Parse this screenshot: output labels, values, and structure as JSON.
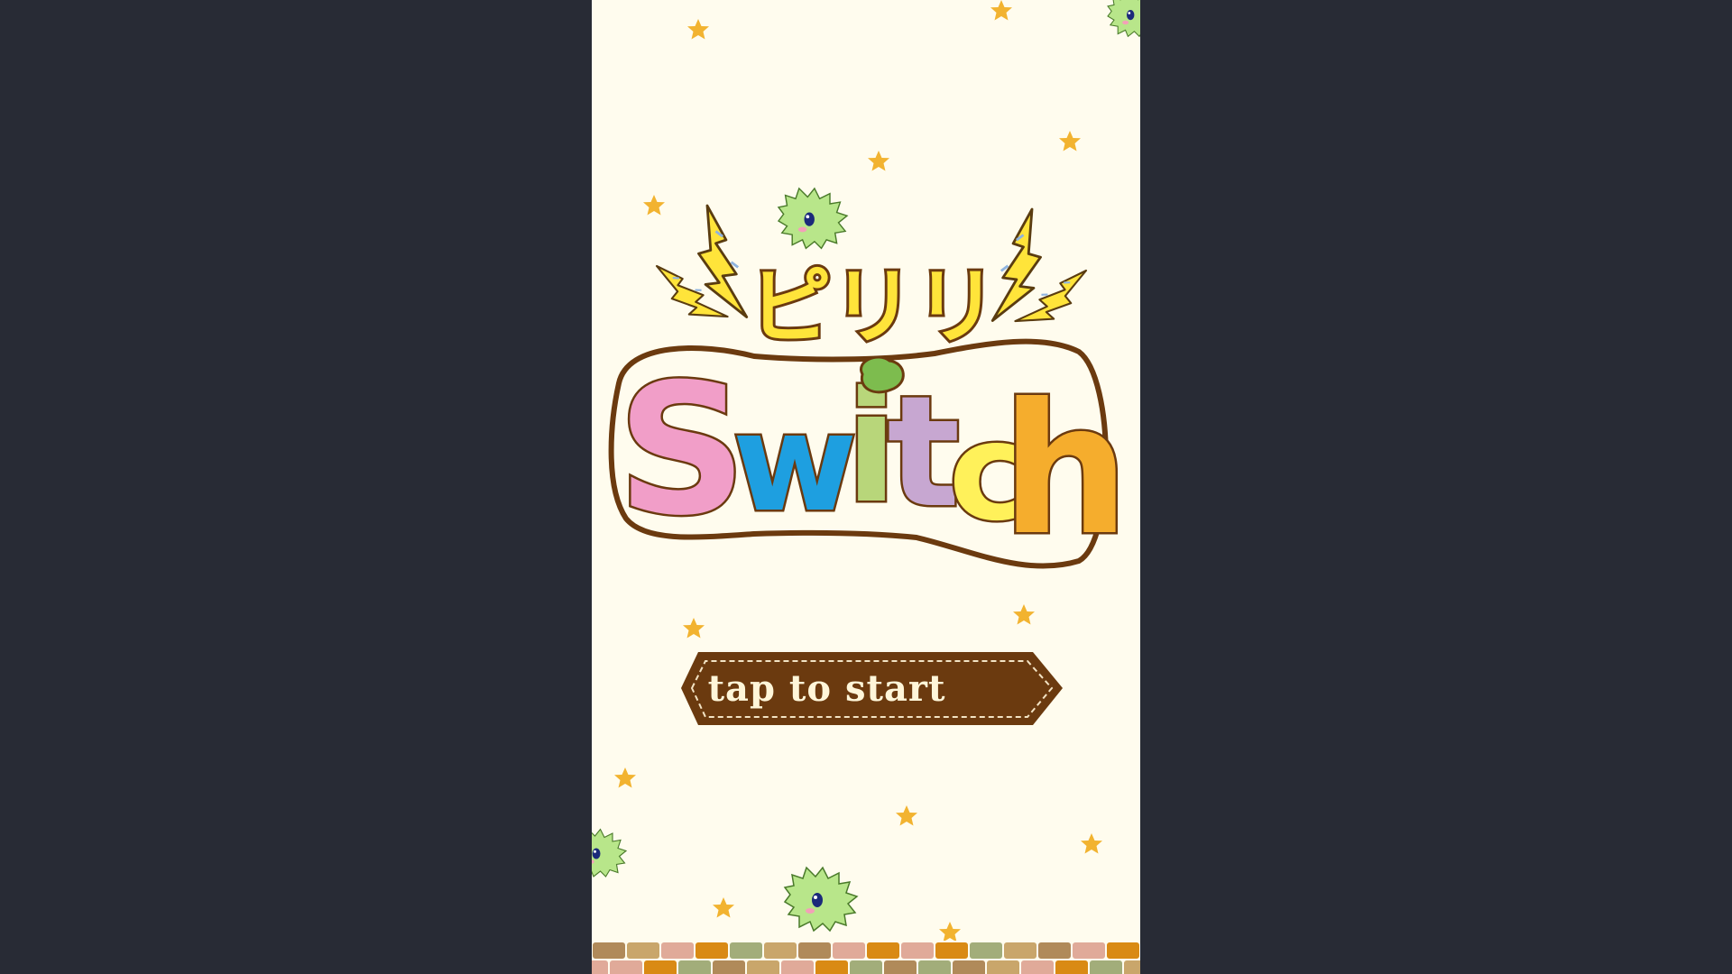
{
  "game": {
    "title_kana": "ピリリ",
    "title_logo": "Switch",
    "start_prompt": "tap to start"
  },
  "colors": {
    "page_background": "#282b35",
    "game_background": "#fffcee",
    "star": "#f2b330",
    "outline_brown": "#6b3a0f",
    "lightning_yellow": "#ffe43a",
    "mascot_green": "#b8e68a",
    "letter_s": "#f19ec8",
    "letter_w": "#1e9fe0",
    "letter_i": "#b8d67a",
    "letter_t": "#c7a7d1",
    "letter_c": "#fff15a",
    "letter_h": "#f5ad2d",
    "button_fill": "#6b3a0f",
    "button_text": "#fff6d9"
  },
  "icons": [
    "star-icon",
    "lightning-icon",
    "green-fluff-mascot-icon",
    "brick-floor"
  ]
}
